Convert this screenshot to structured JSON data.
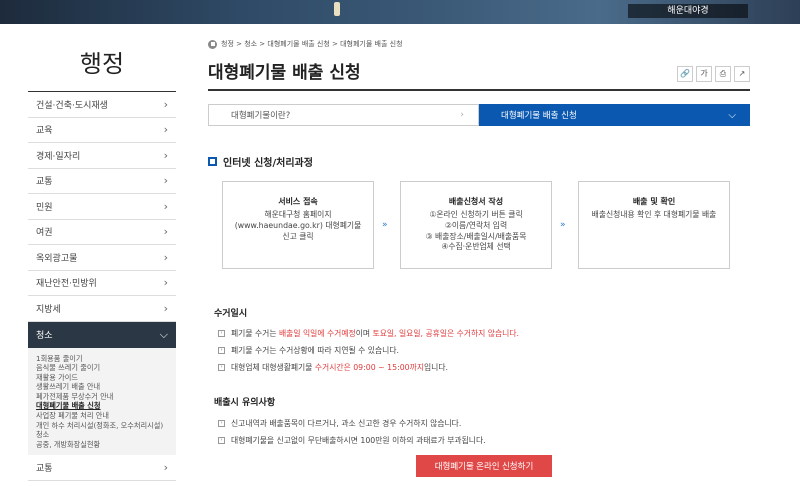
{
  "banner": {
    "caption": "해운대야경"
  },
  "sidebar": {
    "title": "행정",
    "items": [
      {
        "label": "건설·건축·도시재생"
      },
      {
        "label": "교육"
      },
      {
        "label": "경제·일자리"
      },
      {
        "label": "교통"
      },
      {
        "label": "민원"
      },
      {
        "label": "여권"
      },
      {
        "label": "옥외광고물"
      },
      {
        "label": "재난안전·민방위"
      },
      {
        "label": "지방세"
      }
    ],
    "active": {
      "label": "청소"
    },
    "submenu": [
      "1회용품 줄이기",
      "음식물 쓰레기 줄이기",
      "재활용 가이드",
      "생활쓰레기 배출 안내",
      "폐가전제품 무상수거 안내",
      "대형폐기물 배출 신청",
      "사업장 폐기물 처리 안내",
      "개인 하수 처리시설(정화조, 오수처리시설) 청소",
      "공중, 개방화장실현황"
    ],
    "next_item": {
      "label": "교통"
    }
  },
  "breadcrumb": "청정 > 청소 > 대형폐기물 배출 신청 > 대형폐기물 배출 신청",
  "page_title": "대형폐기물 배출 신청",
  "tools": {
    "link": "🔗",
    "font": "가",
    "print": "⎙",
    "share": "↗"
  },
  "tabs": [
    {
      "label": "대형폐기물이란?"
    },
    {
      "label": "대형폐기물 배출 신청"
    }
  ],
  "section_title": "인터넷 신청/처리과정",
  "steps": [
    {
      "title": "서비스 접속",
      "desc": "해운대구청 홈페이지\n(www.haeundae.go.kr) 대형폐기물\n신고 클릭"
    },
    {
      "title": "배출신청서 작성",
      "desc": "①온라인 신청하기 버튼 클릭\n②이름/연락처 입력\n③ 배출장소/배출일시/배출품목\n④수집·운반업체 선택"
    },
    {
      "title": "배출 및 확인",
      "desc": "배출신청내용 확인 후 대형폐기물 배출"
    }
  ],
  "collection": {
    "heading": "수거일시",
    "line1": {
      "pre": "폐기물 수거는 ",
      "red": "배출일 익일에 수거예정",
      "mid": "이며 ",
      "red2": "토요일, 일요일, 공휴일은 수거하지 않습니다."
    },
    "line2": "폐기물 수거는 수거상황에 따라 지연될 수 있습니다.",
    "line3": {
      "pre": "대형업체 대형생활폐기물 ",
      "red": "수거시간은 09:00 ~ 15:00까지",
      "post": "입니다."
    }
  },
  "notes": {
    "heading": "배출시 유의사항",
    "line1": "신고내역과 배출품목이 다르거나, 과소 신고한 경우 수거하지 않습니다.",
    "line2": "대형폐기물을 신고없이 무단배출하시면 100만원 이하의 과태료가 부과됩니다."
  },
  "apply_button": "대형폐기물 온라인 신청하기"
}
